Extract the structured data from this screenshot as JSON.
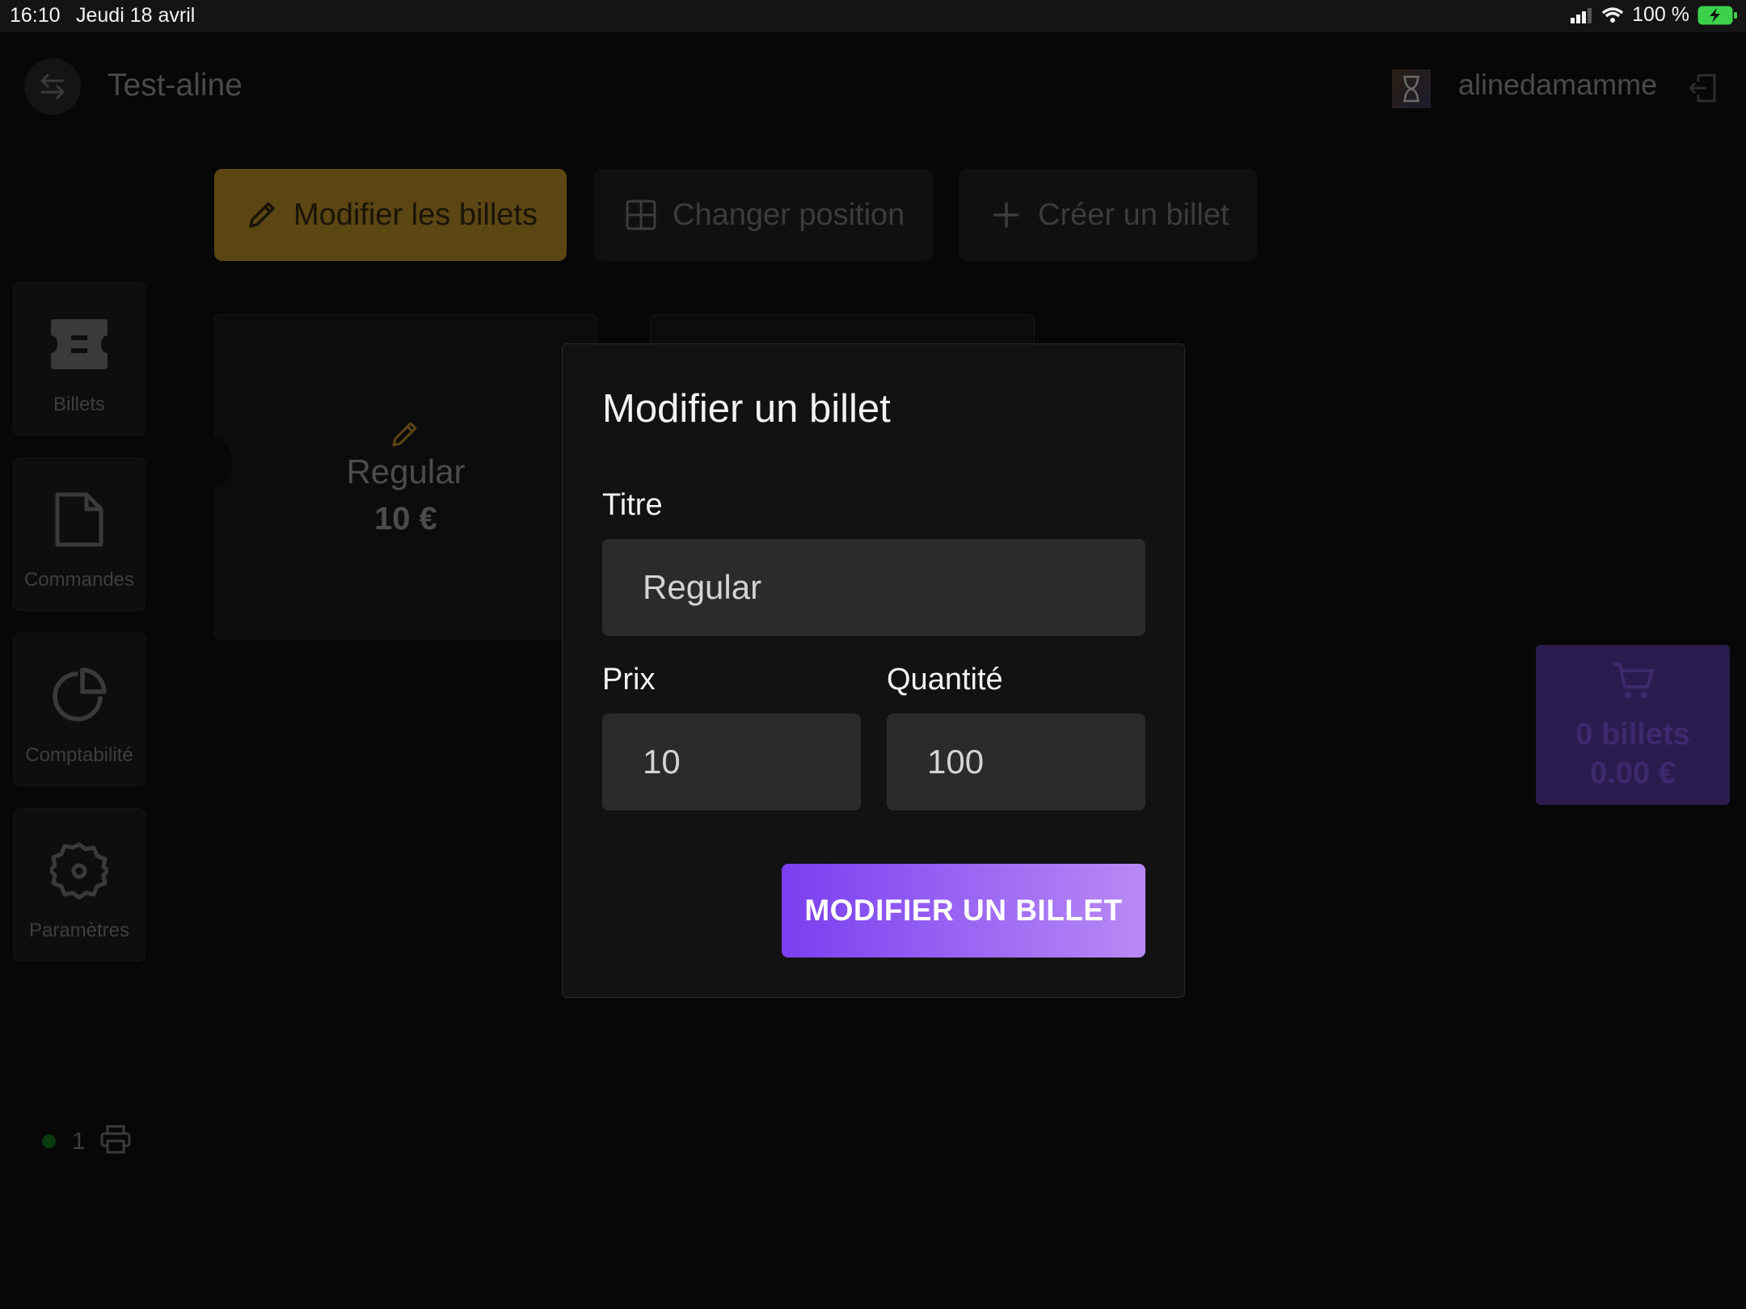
{
  "status_bar": {
    "time": "16:10",
    "date": "Jeudi 18 avril",
    "battery": "100 %"
  },
  "header": {
    "event_title": "Test-aline",
    "username": "alinedamamme"
  },
  "toolbar": {
    "edit_label": "Modifier les billets",
    "position_label": "Changer position",
    "create_label": "Créer un billet"
  },
  "sidebar": {
    "items": [
      {
        "label": "Billets",
        "icon": "ticket-icon"
      },
      {
        "label": "Commandes",
        "icon": "document-icon"
      },
      {
        "label": "Comptabilité",
        "icon": "pie-chart-icon"
      },
      {
        "label": "Paramètres",
        "icon": "gear-icon"
      }
    ]
  },
  "tickets": [
    {
      "name": "Regular",
      "price": "10 €"
    }
  ],
  "cart": {
    "count": "0 billets",
    "total": "0.00 €"
  },
  "printer": {
    "count": "1"
  },
  "modal": {
    "title": "Modifier un billet",
    "titre_label": "Titre",
    "titre_value": "Regular",
    "prix_label": "Prix",
    "prix_value": "10",
    "quantite_label": "Quantité",
    "quantite_value": "100",
    "submit_label": "MODIFIER UN BILLET"
  },
  "colors": {
    "accent_purple": "#8b4cf2",
    "edit_gold": "#5b4614",
    "online_green": "#0b3b10"
  }
}
